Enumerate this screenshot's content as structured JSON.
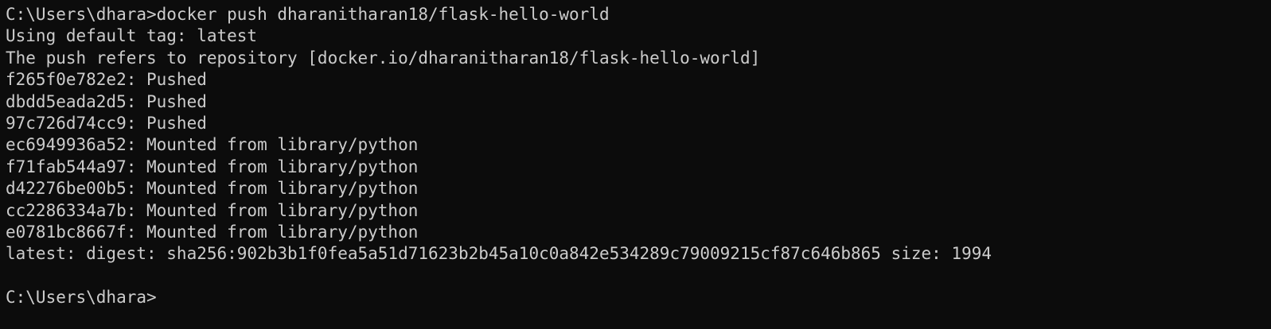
{
  "terminal": {
    "lines": [
      "C:\\Users\\dhara>docker push dharanitharan18/flask-hello-world",
      "Using default tag: latest",
      "The push refers to repository [docker.io/dharanitharan18/flask-hello-world]",
      "f265f0e782e2: Pushed",
      "dbdd5eada2d5: Pushed",
      "97c726d74cc9: Pushed",
      "ec6949936a52: Mounted from library/python",
      "f71fab544a97: Mounted from library/python",
      "d42276be00b5: Mounted from library/python",
      "cc2286334a7b: Mounted from library/python",
      "e0781bc8667f: Mounted from library/python",
      "latest: digest: sha256:902b3b1f0fea5a51d71623b2b45a10c0a842e534289c79009215cf87c646b865 size: 1994",
      "",
      "C:\\Users\\dhara>"
    ],
    "colors": {
      "background": "#0c0c0c",
      "foreground": "#cccccc"
    }
  }
}
